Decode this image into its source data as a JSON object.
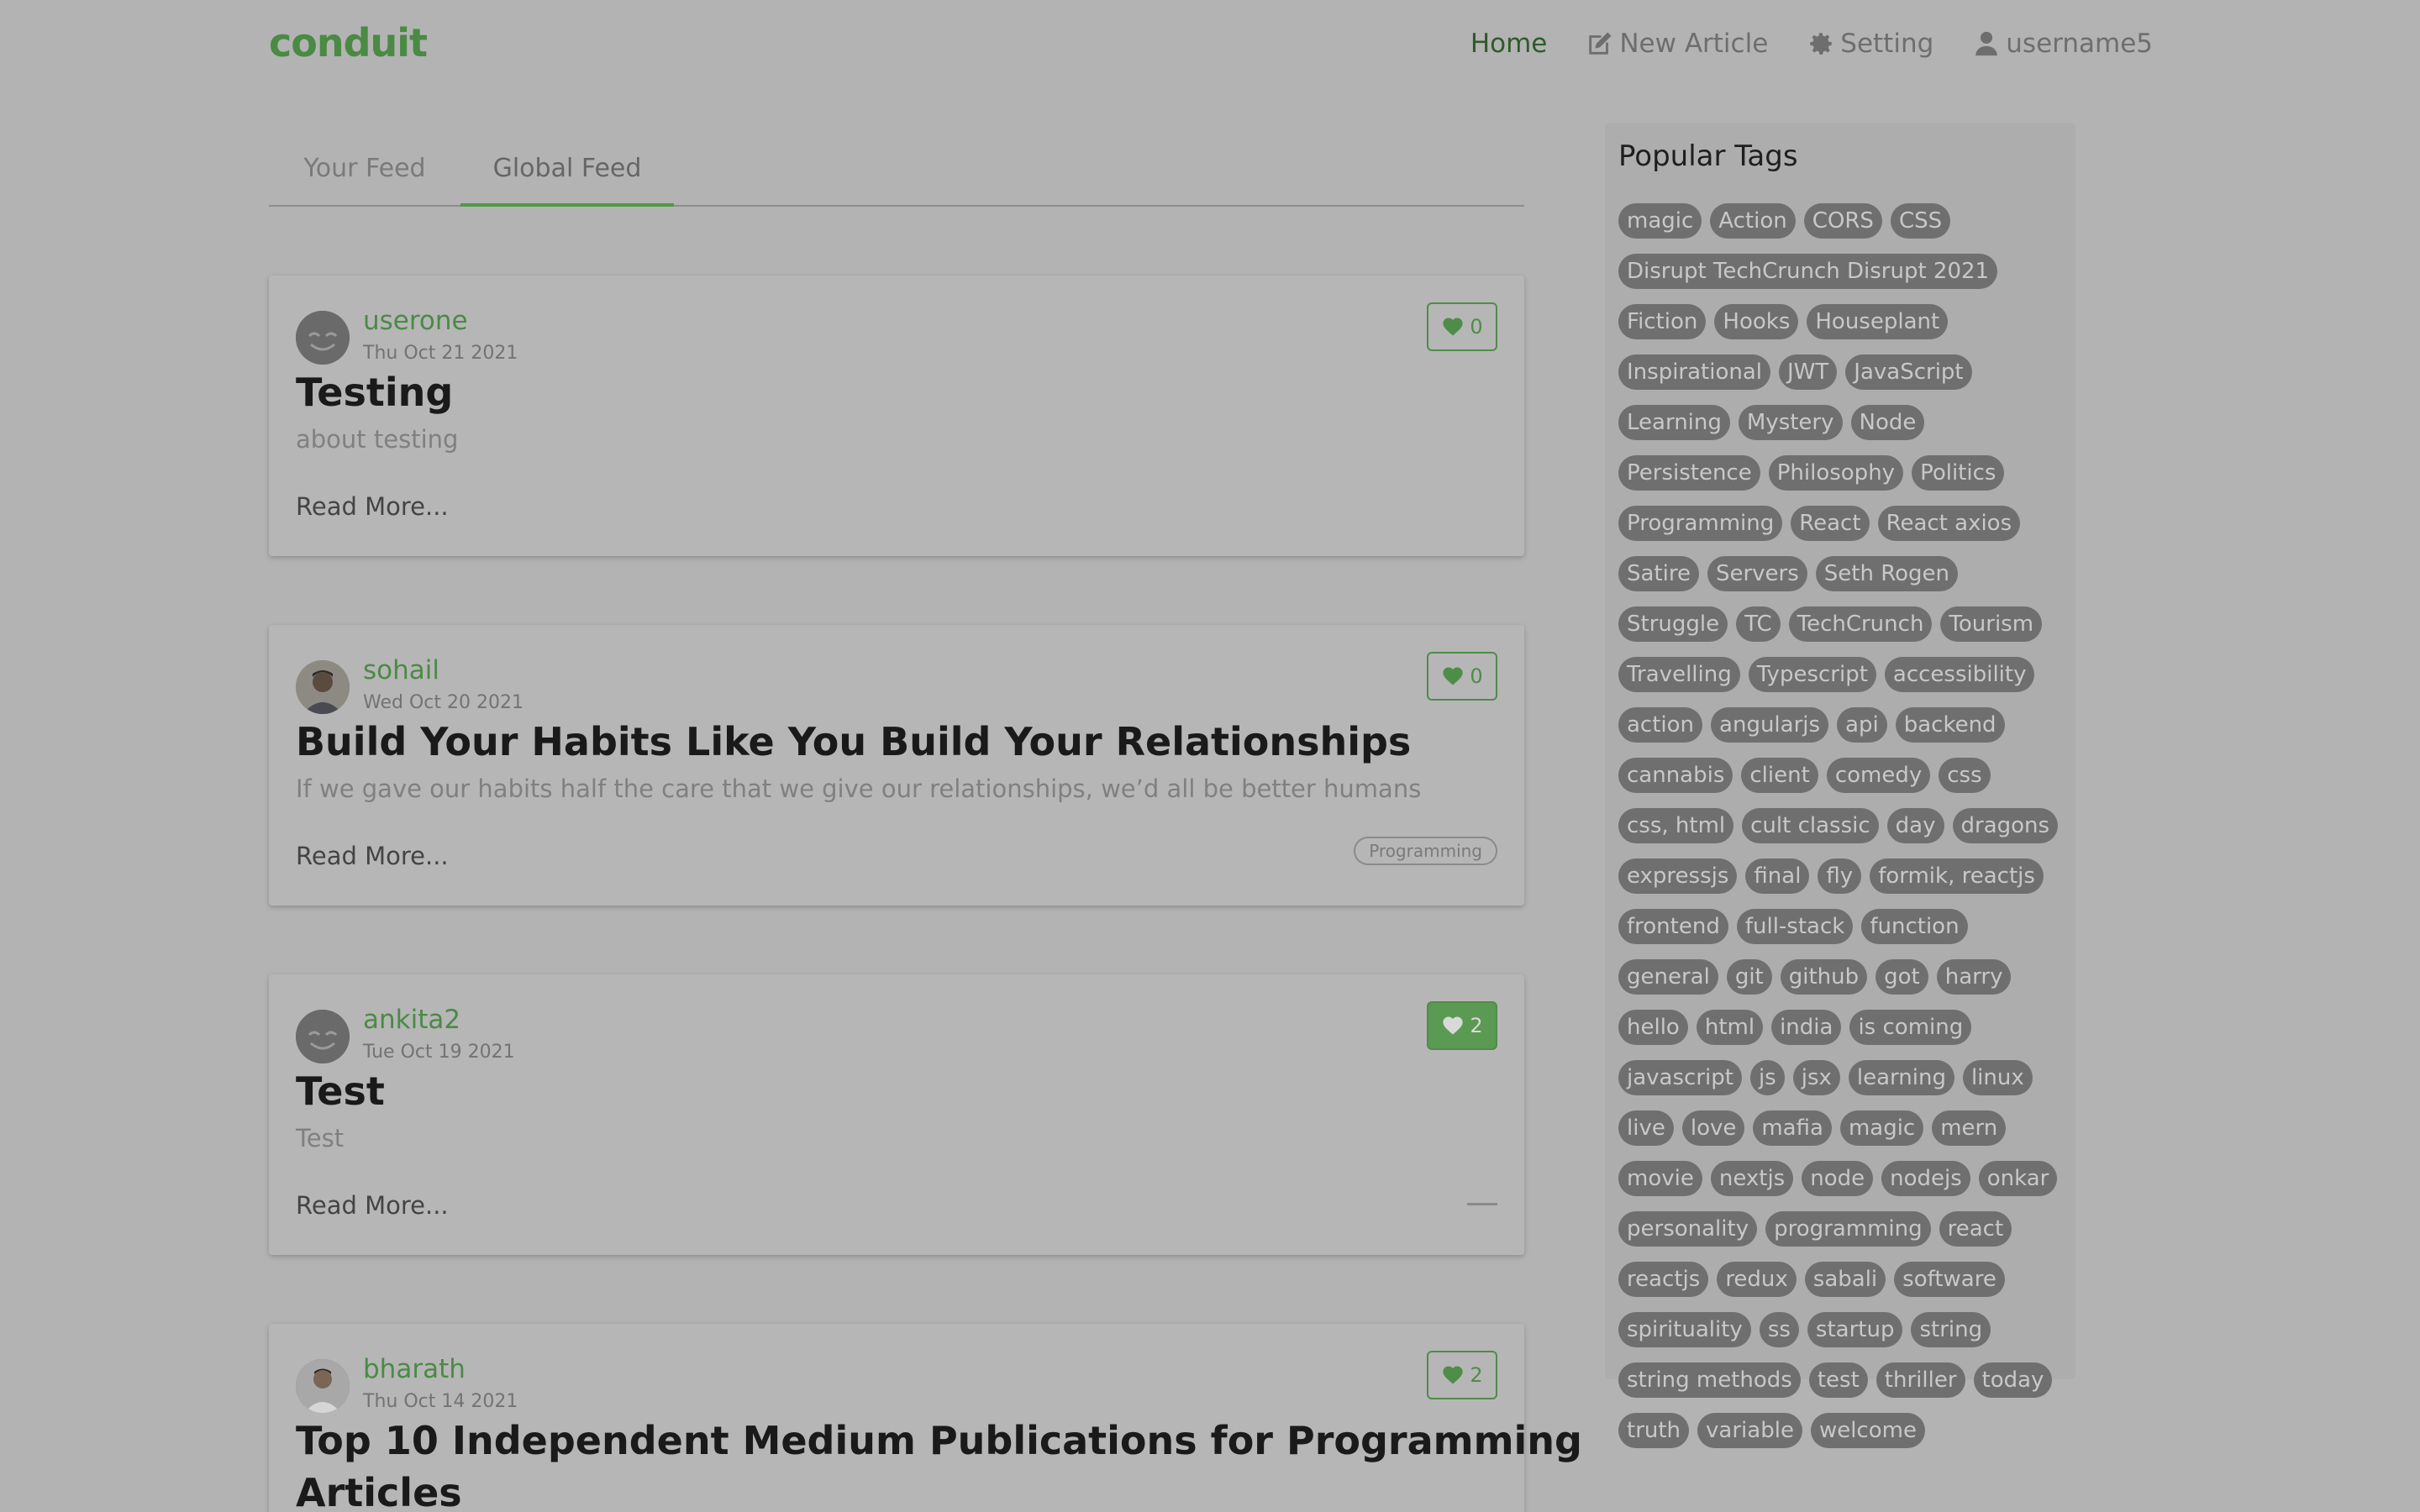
{
  "brand": "conduit",
  "nav": {
    "home": "Home",
    "new_article": "New Article",
    "setting": "Setting",
    "user": "username5"
  },
  "tabs": {
    "your_feed": "Your Feed",
    "global_feed": "Global Feed"
  },
  "articles": [
    {
      "author": "userone",
      "date": "Thu Oct 21 2021",
      "likes": "0",
      "title": "Testing",
      "description": "about testing",
      "read_more": "Read More...",
      "tag": "",
      "avatar": "smiley",
      "liked": false
    },
    {
      "author": "sohail",
      "date": "Wed Oct 20 2021",
      "likes": "0",
      "title": "Build Your Habits Like You Build Your Relationships",
      "description": "If we gave our habits half the care that we give our relationships, we’d all be better humans",
      "read_more": "Read More...",
      "tag": "Programming",
      "avatar": "photo",
      "liked": false
    },
    {
      "author": "ankita2",
      "date": "Tue Oct 19 2021",
      "likes": "2",
      "title": "Test",
      "description": "Test",
      "read_more": "Read More...",
      "tag": "",
      "avatar": "smiley",
      "liked": true
    },
    {
      "author": "bharath",
      "date": "Thu Oct 14 2021",
      "likes": "2",
      "title": "Top 10 Independent Medium Publications for Programming",
      "title_line2": "Articles",
      "description": "",
      "read_more": "",
      "tag": "",
      "avatar": "photo",
      "liked": false
    }
  ],
  "sidebar": {
    "title": "Popular Tags",
    "tags": [
      "magic",
      "Action",
      "CORS",
      "CSS",
      "Disrupt TechCrunch Disrupt 2021",
      "Fiction",
      "Hooks",
      "Houseplant",
      "Inspirational",
      "JWT",
      "JavaScript",
      "Learning",
      "Mystery",
      "Node",
      "Persistence",
      "Philosophy",
      "Politics",
      "Programming",
      "React",
      "React axios",
      "Satire",
      "Servers",
      "Seth Rogen",
      "Struggle",
      "TC",
      "TechCrunch",
      "Tourism",
      "Travelling",
      "Typescript",
      "accessibility",
      "action",
      "angularjs",
      "api",
      "backend",
      "cannabis",
      "client",
      "comedy",
      "css",
      "css, html",
      "cult classic",
      "day",
      "dragons",
      "expressjs",
      "final",
      "fly",
      "formik, reactjs",
      "frontend",
      "full-stack",
      "function",
      "general",
      "git",
      "github",
      "got",
      "harry",
      "hello",
      "html",
      "india",
      "is coming",
      "javascript",
      "js",
      "jsx",
      "learning",
      "linux",
      "live",
      "love",
      "mafia",
      "magic",
      "mern",
      "movie",
      "nextjs",
      "node",
      "nodejs",
      "onkar",
      "personality",
      "programming",
      "react",
      "reactjs",
      "redux",
      "sabali",
      "software",
      "spirituality",
      "ss",
      "startup",
      "string",
      "string methods",
      "test",
      "thriller",
      "today",
      "truth",
      "variable",
      "welcome"
    ]
  },
  "colors": {
    "brand": "#4a8a44",
    "overlay_bg": "#b3b3b3",
    "tag_bg": "#6f6f6f"
  }
}
